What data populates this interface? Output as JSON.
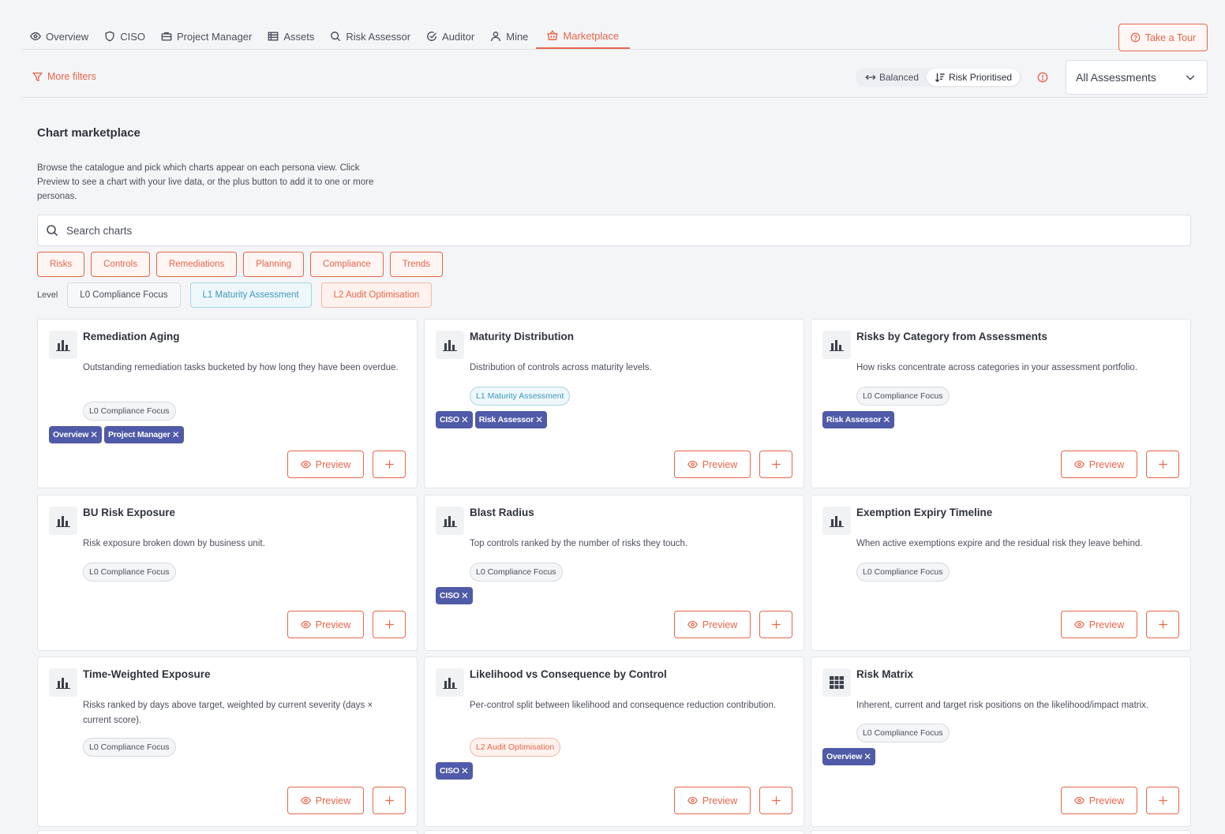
{
  "nav": {
    "tabs": [
      {
        "label": "Overview",
        "icon": "eye-icon"
      },
      {
        "label": "CISO",
        "icon": "shield-icon"
      },
      {
        "label": "Project Manager",
        "icon": "briefcase-icon"
      },
      {
        "label": "Assets",
        "icon": "table-icon"
      },
      {
        "label": "Risk Assessor",
        "icon": "search-icon"
      },
      {
        "label": "Auditor",
        "icon": "check-circle-icon"
      },
      {
        "label": "Mine",
        "icon": "user-icon"
      },
      {
        "label": "Marketplace",
        "icon": "basket-icon"
      }
    ],
    "active_tab": "Marketplace",
    "tour_label": "Take a Tour"
  },
  "filters": {
    "more_filters_label": "More filters",
    "mode_balanced": "Balanced",
    "mode_risk": "Risk Prioritised",
    "assessment_select": "All Assessments"
  },
  "page": {
    "title": "Chart marketplace",
    "description": "Browse the catalogue and pick which charts appear on each persona view. Click Preview to see a chart with your live data, or the plus button to add it to one or more personas.",
    "search_placeholder": "Search charts"
  },
  "categories": [
    "Risks",
    "Controls",
    "Remediations",
    "Planning",
    "Compliance",
    "Trends"
  ],
  "levels": {
    "label": "Level",
    "items": [
      "L0 Compliance Focus",
      "L1 Maturity Assessment",
      "L2 Audit Optimisation"
    ]
  },
  "card_labels": {
    "preview": "Preview"
  },
  "cards": [
    {
      "title": "Remediation Aging",
      "description": "Outstanding remediation tasks bucketed by how long they have been overdue.",
      "level": "L0 Compliance Focus",
      "personas": [
        "Overview",
        "Project Manager"
      ],
      "icon": "bar-chart-icon"
    },
    {
      "title": "Maturity Distribution",
      "description": "Distribution of controls across maturity levels.",
      "level": "L1 Maturity Assessment",
      "personas": [
        "CISO",
        "Risk Assessor"
      ],
      "icon": "bar-chart-icon"
    },
    {
      "title": "Risks by Category from Assessments",
      "description": "How risks concentrate across categories in your assessment portfolio.",
      "level": "L0 Compliance Focus",
      "personas": [
        "Risk Assessor"
      ],
      "icon": "bar-chart-icon"
    },
    {
      "title": "BU Risk Exposure",
      "description": "Risk exposure broken down by business unit.",
      "level": "L0 Compliance Focus",
      "personas": [],
      "icon": "bar-chart-icon"
    },
    {
      "title": "Blast Radius",
      "description": "Top controls ranked by the number of risks they touch.",
      "level": "L0 Compliance Focus",
      "personas": [
        "CISO"
      ],
      "icon": "bar-chart-icon"
    },
    {
      "title": "Exemption Expiry Timeline",
      "description": "When active exemptions expire and the residual risk they leave behind.",
      "level": "L0 Compliance Focus",
      "personas": [],
      "icon": "bar-chart-icon"
    },
    {
      "title": "Time-Weighted Exposure",
      "description": "Risks ranked by days above target, weighted by current severity (days × current score).",
      "level": "L0 Compliance Focus",
      "personas": [],
      "icon": "bar-chart-icon"
    },
    {
      "title": "Likelihood vs Consequence by Control",
      "description": "Per-control split between likelihood and consequence reduction contribution.",
      "level": "L2 Audit Optimisation",
      "personas": [
        "CISO"
      ],
      "icon": "bar-chart-icon"
    },
    {
      "title": "Risk Matrix",
      "description": "Inherent, current and target risk positions on the likelihood/impact matrix.",
      "level": "L0 Compliance Focus",
      "personas": [
        "Overview"
      ],
      "icon": "grid-icon"
    }
  ],
  "colors": {
    "accent": "#e8654a",
    "persona": "#4f5aa8",
    "l1": "#3f98bd"
  }
}
